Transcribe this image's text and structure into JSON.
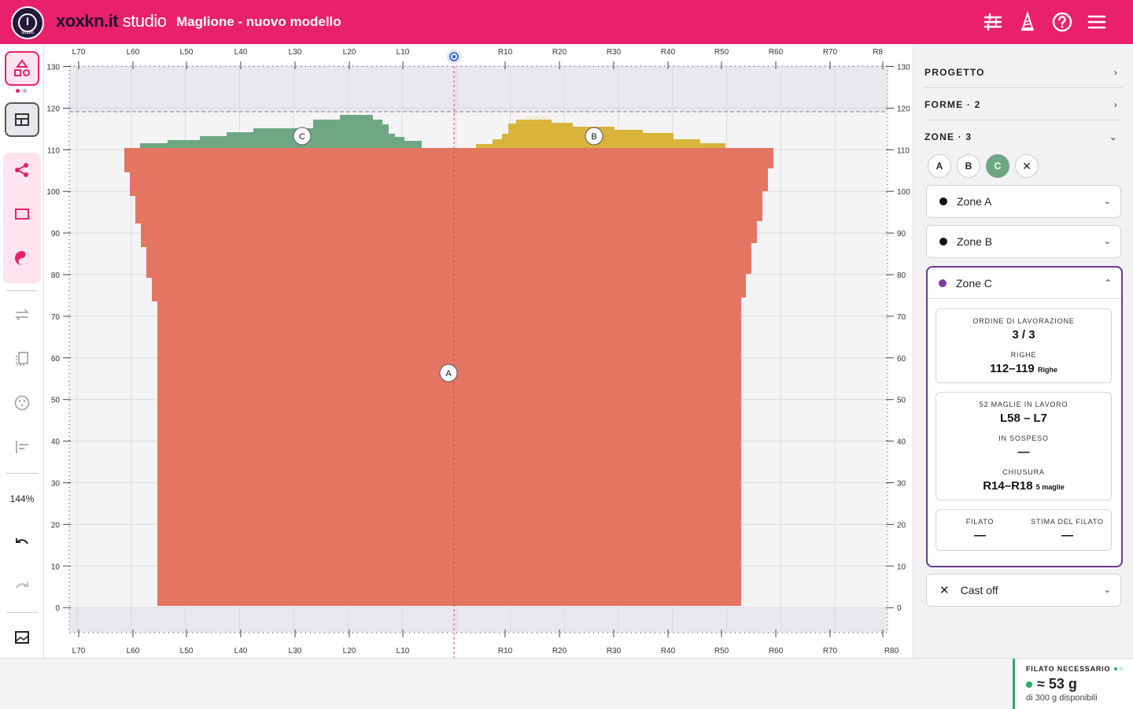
{
  "header": {
    "logo_text": "studio",
    "brand_main": "xoxkn.it",
    "brand_sub": " studio",
    "document_title": "Maglione - nuovo modello",
    "icons": [
      "sliders-icon",
      "yarn-cone-icon",
      "help-icon",
      "menu-icon"
    ]
  },
  "toolbar": {
    "zoom": "144%",
    "icons": [
      "shapes-icon",
      "layout-icon",
      "share-nodes-icon",
      "rectangle-icon",
      "yin-yang-icon",
      "swap-icon",
      "copy-icon",
      "palette-icon",
      "align-icon",
      "undo-icon",
      "redo-icon",
      "image-icon"
    ]
  },
  "ruler": {
    "top": [
      "L70",
      "L60",
      "L50",
      "L40",
      "L30",
      "L20",
      "L10",
      "R10",
      "R20",
      "R30",
      "R40",
      "R50",
      "R60",
      "R70",
      "R8"
    ],
    "bottom": [
      "L70",
      "L60",
      "L50",
      "L40",
      "L30",
      "L20",
      "L10",
      "R10",
      "R20",
      "R30",
      "R40",
      "R50",
      "R60",
      "R70",
      "R80"
    ],
    "rows": [
      "130",
      "120",
      "110",
      "100",
      "90",
      "80",
      "70",
      "60",
      "50",
      "40",
      "30",
      "20",
      "10",
      "0"
    ]
  },
  "zones": {
    "A": {
      "label": "A",
      "color": "#e57563"
    },
    "B": {
      "label": "B",
      "color": "#d8b43a"
    },
    "C": {
      "label": "C",
      "color": "#6fa785"
    }
  },
  "panel": {
    "progetto": "PROGETTO",
    "forme": "FORME · 2",
    "zone_header": "ZONE · 3",
    "chips": [
      "A",
      "B",
      "C"
    ],
    "zone_a": "Zone A",
    "zone_b": "Zone B",
    "zone_c": "Zone C",
    "ordine_label": "ORDINE DI LAVORAZIONE",
    "ordine_value": "3 / 3",
    "righe_label": "RIGHE",
    "righe_value": "112–119",
    "righe_unit": "Righe",
    "maglie_label": "52 MAGLIE IN LAVORO",
    "maglie_value": "L58 – L7",
    "sospeso_label": "IN SOSPESO",
    "sospeso_value": "—",
    "chiusura_label": "CHIUSURA",
    "chiusura_value": "R14–R18",
    "chiusura_unit": "5 maglie",
    "filato_label": "FILATO",
    "filato_value": "—",
    "stima_label": "STIMA DEL FILATO",
    "stima_value": "—",
    "cast_off": "Cast off"
  },
  "footer": {
    "yarn_label": "FILATO NECESSARIO",
    "yarn_value": "≈ 53 g",
    "yarn_available": "di 300 g disponibili"
  }
}
